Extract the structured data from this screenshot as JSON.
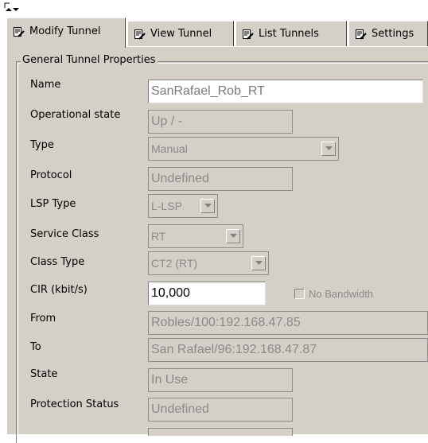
{
  "tabs": [
    {
      "label": "Modify Tunnel",
      "active": true,
      "icon": "edit-document-icon"
    },
    {
      "label": "View Tunnel",
      "active": false,
      "icon": "edit-document-icon"
    },
    {
      "label": "List Tunnels",
      "active": false,
      "icon": "edit-document-icon"
    },
    {
      "label": "Settings",
      "active": false,
      "icon": "edit-document-icon"
    }
  ],
  "group": {
    "title": "General Tunnel Properties"
  },
  "fields": {
    "name": {
      "label": "Name",
      "value": "SanRafael_Rob_RT"
    },
    "operational_state": {
      "label": "Operational state",
      "value": "Up / -"
    },
    "type": {
      "label": "Type",
      "value": "Manual"
    },
    "protocol": {
      "label": "Protocol",
      "value": "Undefined"
    },
    "lsp_type": {
      "label": "LSP Type",
      "value": "L-LSP"
    },
    "service_class": {
      "label": "Service Class",
      "value": "RT"
    },
    "class_type": {
      "label": "Class Type",
      "value": "CT2 (RT)"
    },
    "cir": {
      "label": "CIR (kbit/s)",
      "value": "10,000"
    },
    "no_bandwidth": {
      "label": "No Bandwidth",
      "checked": false
    },
    "from": {
      "label": "From",
      "value": "Robles/100:192.168.47.85"
    },
    "to": {
      "label": "To",
      "value": "San Rafael/96:192.168.47.87"
    },
    "state": {
      "label": "State",
      "value": "In Use"
    },
    "protection_status": {
      "label": "Protection Status",
      "value": "Undefined"
    }
  },
  "colors": {
    "panel": "#d4d0c8",
    "disabled_text": "#8a8a8a"
  }
}
